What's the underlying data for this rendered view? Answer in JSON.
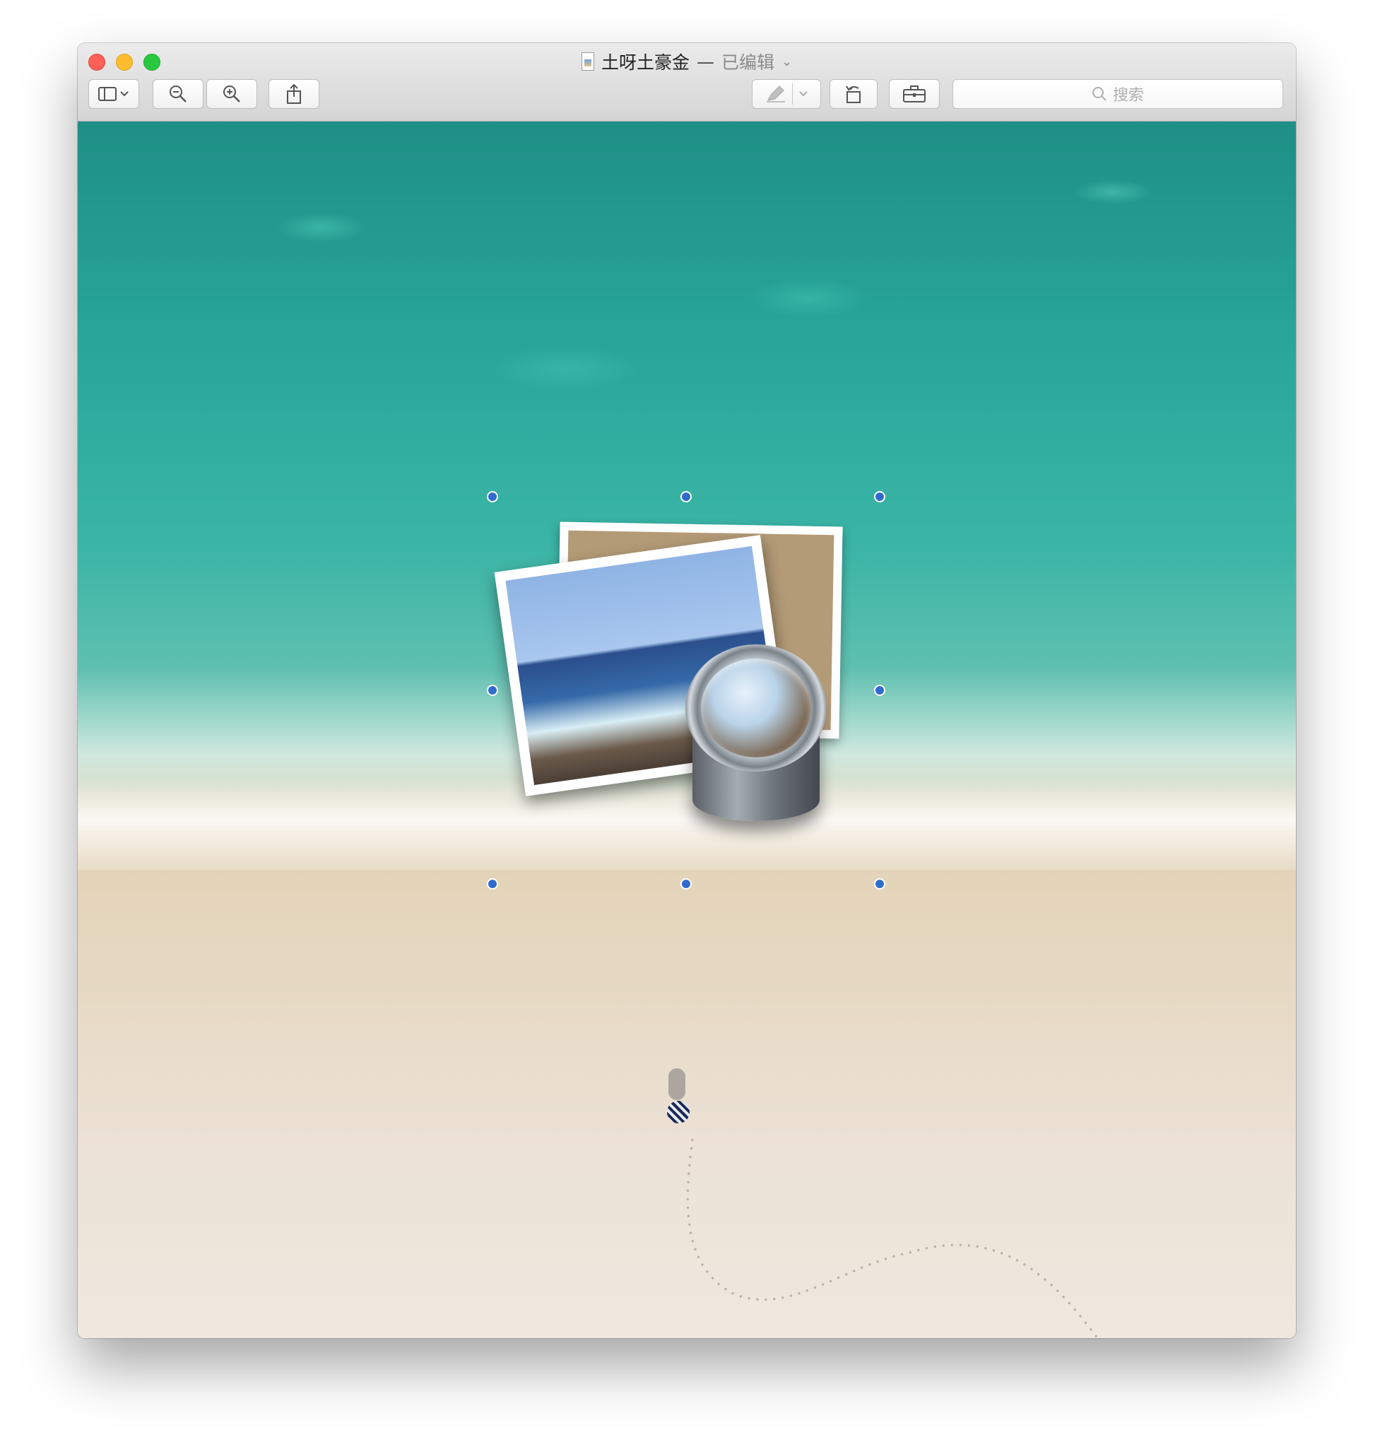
{
  "window": {
    "title": "土呀土豪金",
    "separator": "—",
    "edited_label": "已编辑",
    "title_chevron_icon": "chevron-down-icon",
    "traffic_lights": {
      "close_color": "#fe5f57",
      "minimize_color": "#febc2e",
      "maximize_color": "#28c840"
    }
  },
  "toolbar": {
    "sidebar_button_icon": "sidebar-icon",
    "sidebar_chevron_icon": "chevron-down-icon",
    "zoom_out_icon": "zoom-out-icon",
    "zoom_in_icon": "zoom-in-icon",
    "share_icon": "share-icon",
    "markup_icon": "pen-icon",
    "markup_chevron_icon": "chevron-down-icon",
    "rotate_icon": "rotate-left-icon",
    "toolbox_icon": "toolbox-icon",
    "search": {
      "placeholder": "搜索",
      "icon": "search-icon"
    }
  },
  "canvas": {
    "image_content": "beach-wallpaper-with-preview-app-icon",
    "selection_handle_color": "#2f6ccd",
    "selection_handle_count": 8
  }
}
